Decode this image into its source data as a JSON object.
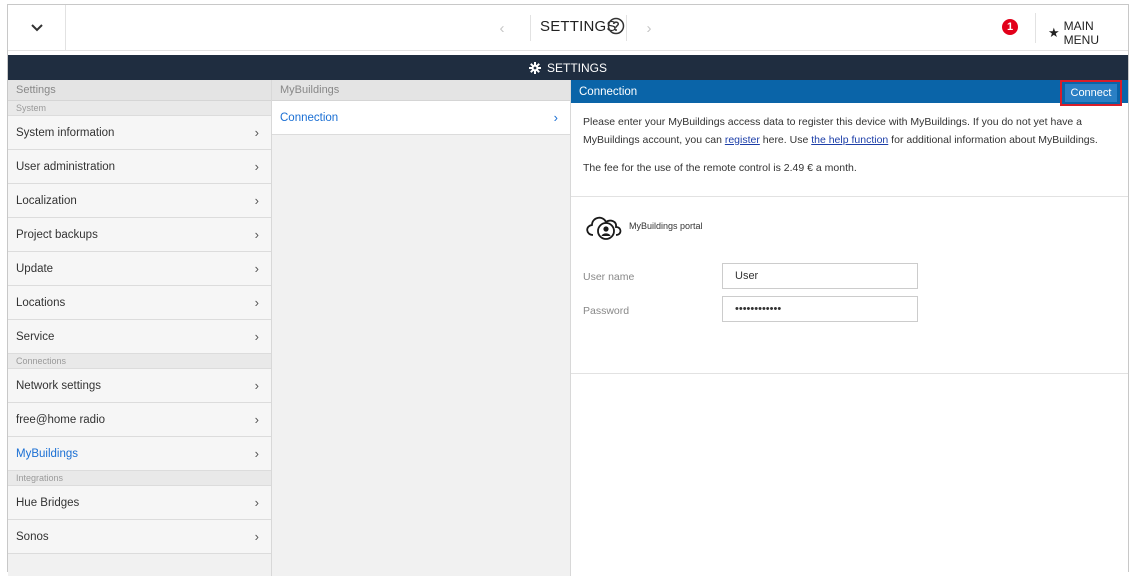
{
  "topbar": {
    "title": "SETTINGS",
    "notification_count": "1",
    "main_menu_label": "MAIN MENU"
  },
  "darkbar": {
    "title": "SETTINGS"
  },
  "col1": {
    "header": "Settings",
    "sections": [
      {
        "label": "System",
        "items": [
          "System information",
          "User administration",
          "Localization",
          "Project backups",
          "Update",
          "Locations",
          "Service"
        ]
      },
      {
        "label": "Connections",
        "items": [
          "Network settings",
          "free@home radio",
          "MyBuildings"
        ]
      },
      {
        "label": "Integrations",
        "items": [
          "Hue Bridges",
          "Sonos"
        ]
      }
    ]
  },
  "col2": {
    "header": "MyBuildings",
    "item": "Connection"
  },
  "col3": {
    "header": "Connection",
    "connect_label": "Connect",
    "intro1_a": "Please enter your MyBuildings access data to register this device with MyBuildings. If you do not yet have a MyBuildings account, you can ",
    "intro1_link1": "register",
    "intro1_b": " here. Use ",
    "intro1_link2": "the help function",
    "intro1_c": " for additional information about MyBuildings.",
    "intro2": "The fee for the use of the remote control is 2.49 € a month.",
    "portal_label": "MyBuildings portal",
    "username_label": "User name",
    "username_value": "User",
    "password_label": "Password",
    "password_value": "••••••••••••"
  },
  "colors": {
    "accent": "#0a64a8",
    "dark": "#1f2d40",
    "highlight": "#d81e2a",
    "link": "#1a6fd4"
  }
}
